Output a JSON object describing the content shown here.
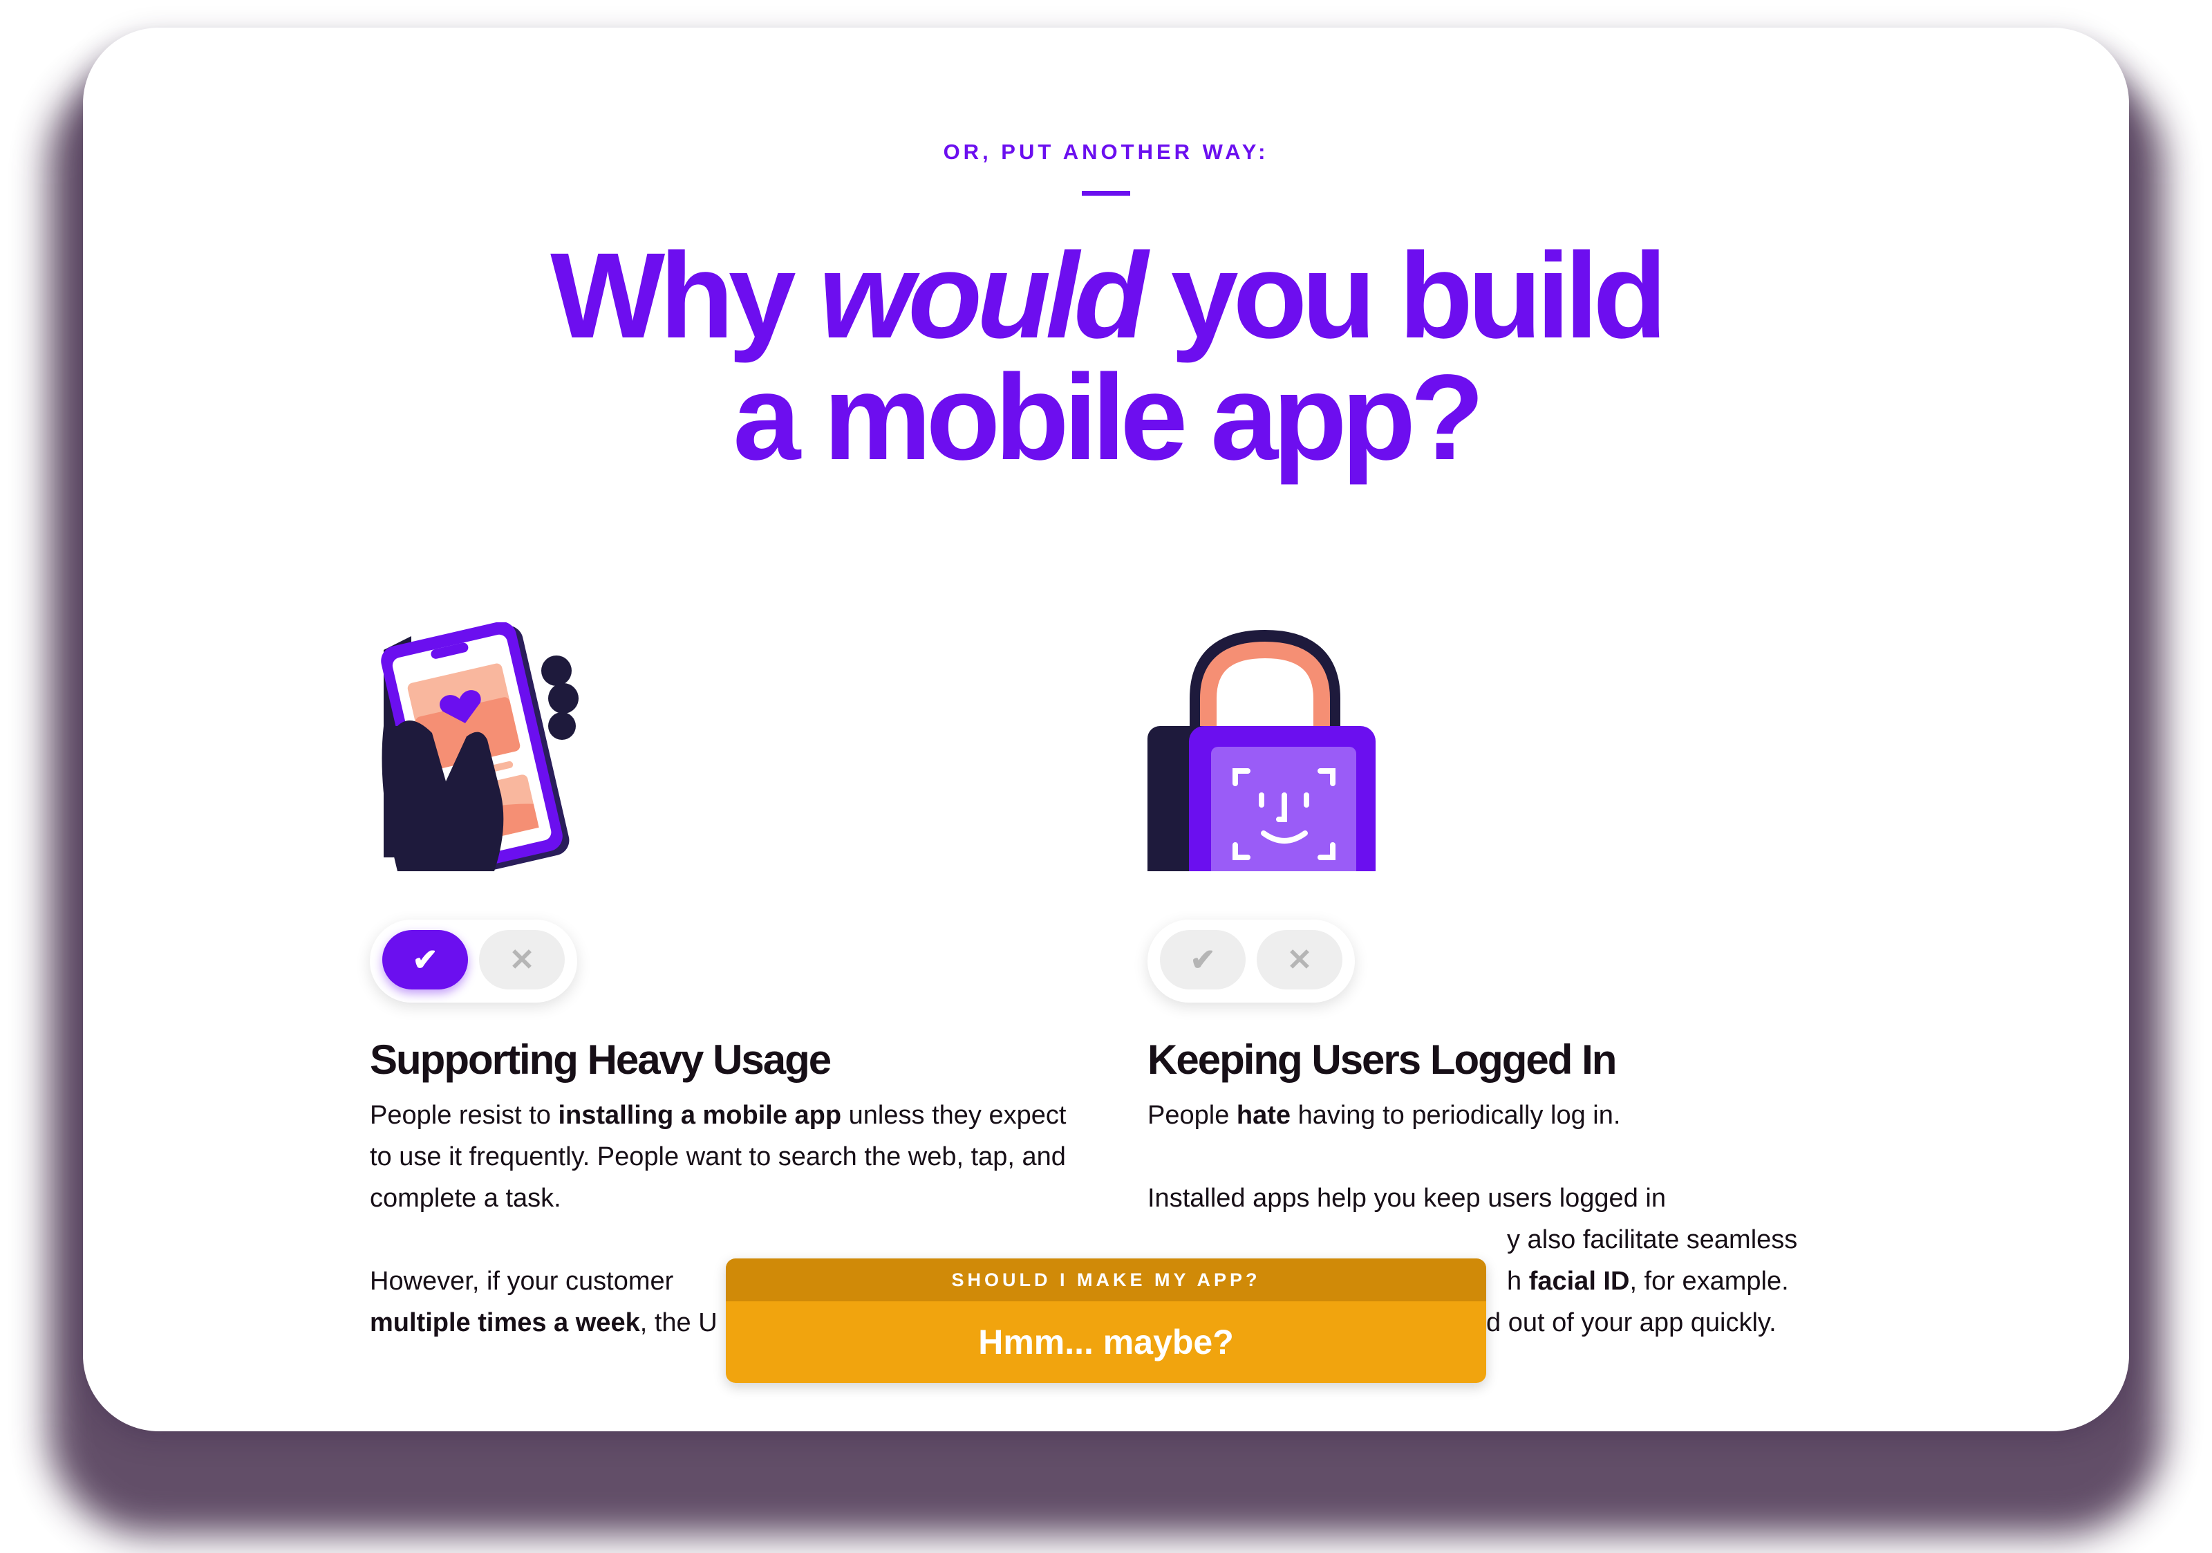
{
  "eyebrow": "OR, PUT ANOTHER WAY:",
  "headline": {
    "line1_pre": "Why ",
    "line1_em": "would",
    "line1_post": " you build",
    "line2": "a mobile app?"
  },
  "left": {
    "title": "Supporting Heavy Usage",
    "toggle": {
      "check": "✔",
      "cross": "✕",
      "selected": "check"
    },
    "p1": {
      "a": "People resist to ",
      "b": "installing a mobile app",
      "c": " unless they expect to use it frequently. People want to search the web, tap, and complete a task."
    },
    "p2": {
      "a": "However, if your customer",
      "b": "multiple times a week",
      "c": ", the U"
    }
  },
  "right": {
    "title": "Keeping Users Logged In",
    "toggle": {
      "check": "✔",
      "cross": "✕",
      "selected": "none"
    },
    "p1": {
      "a": "People ",
      "b": "hate",
      "c": " having to periodically log in."
    },
    "p2": {
      "a": "Installed apps help you keep users logged in",
      "b": "y also facilitate seamless",
      "c": "h ",
      "d": "facial ID",
      "e": ", for example.",
      "f": "d out of your app quickly."
    }
  },
  "banner": {
    "label": "SHOULD I MAKE MY APP?",
    "answer": "Hmm... maybe?"
  },
  "colors": {
    "purple": "#6b0fef",
    "navy": "#1e1a3c",
    "salmon": "#f58f74",
    "banner_dark": "#d08a08",
    "banner_light": "#f1a40e"
  }
}
